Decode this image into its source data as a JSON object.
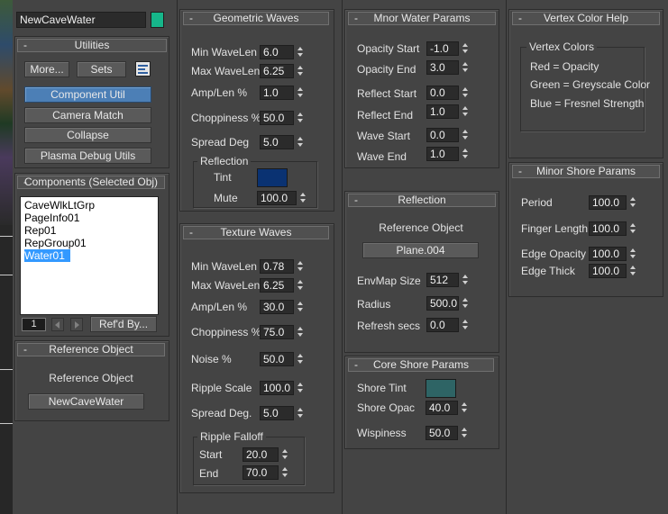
{
  "object_name": "NewCaveWater",
  "colors": {
    "object_color": "#16b68a",
    "reflection_tint": "#0a3272",
    "shore_tint": "#2e6465",
    "selected": "#3399ff",
    "active_button": "#4c7fb6"
  },
  "utilities": {
    "title": "Utilities",
    "more": "More...",
    "sets": "Sets",
    "config_icon": "configure-icon",
    "buttons": [
      "Component Util",
      "Camera Match",
      "Collapse",
      "Plasma Debug Utils"
    ]
  },
  "components": {
    "title": "Components (Selected Obj)",
    "items": [
      "CaveWlkLtGrp",
      "PageInfo01",
      "Rep01",
      "RepGroup01",
      "Water01"
    ],
    "page": "1",
    "refd_by": "Ref'd By..."
  },
  "reference_object_left": {
    "title": "Reference Object",
    "label": "Reference Object",
    "button": "NewCaveWater"
  },
  "geometric_waves": {
    "title": "Geometric Waves",
    "min_wavelen": {
      "label": "Min WaveLen",
      "value": "6.0"
    },
    "max_wavelen": {
      "label": "Max WaveLen",
      "value": "6.25"
    },
    "amp_len": {
      "label": "Amp/Len %",
      "value": "1.0"
    },
    "choppiness": {
      "label": "Choppiness %",
      "value": "50.0"
    },
    "spread": {
      "label": "Spread Deg",
      "value": "5.0"
    },
    "reflection_group": "Reflection",
    "tint_label": "Tint",
    "mute": {
      "label": "Mute",
      "value": "100.0"
    }
  },
  "texture_waves": {
    "title": "Texture Waves",
    "min_wavelen": {
      "label": "Min WaveLen",
      "value": "0.78"
    },
    "max_wavelen": {
      "label": "Max WaveLen",
      "value": "6.25"
    },
    "amp_len": {
      "label": "Amp/Len %",
      "value": "30.0"
    },
    "choppiness": {
      "label": "Choppiness %",
      "value": "75.0"
    },
    "noise": {
      "label": "Noise %",
      "value": "50.0"
    },
    "ripple_scale": {
      "label": "Ripple Scale",
      "value": "100.0"
    },
    "spread": {
      "label": "Spread Deg.",
      "value": "5.0"
    },
    "ripple_falloff_group": "Ripple Falloff",
    "start": {
      "label": "Start",
      "value": "20.0"
    },
    "end": {
      "label": "End",
      "value": "70.0"
    }
  },
  "minor_water": {
    "title": "Mnor Water Params",
    "opacity_start": {
      "label": "Opacity Start",
      "value": "-1.0"
    },
    "opacity_end": {
      "label": "Opacity End",
      "value": "3.0"
    },
    "reflect_start": {
      "label": "Reflect Start",
      "value": "0.0"
    },
    "reflect_end": {
      "label": "Reflect End",
      "value": "1.0"
    },
    "wave_start": {
      "label": "Wave Start",
      "value": "0.0"
    },
    "wave_end": {
      "label": "Wave End",
      "value": "1.0"
    }
  },
  "reflection": {
    "title": "Reflection",
    "ref_label": "Reference Object",
    "ref_button": "Plane.004",
    "envmap": {
      "label": "EnvMap Size",
      "value": "512"
    },
    "radius": {
      "label": "Radius",
      "value": "500.0"
    },
    "refresh": {
      "label": "Refresh secs",
      "value": "0.0"
    }
  },
  "core_shore": {
    "title": "Core Shore Params",
    "tint_label": "Shore Tint",
    "opac": {
      "label": "Shore Opac",
      "value": "40.0"
    },
    "wispiness": {
      "label": "Wispiness",
      "value": "50.0"
    }
  },
  "vertex_help": {
    "title": "Vertex Color Help",
    "group": "Vertex Colors",
    "lines": [
      "Red = Opacity",
      "Green = Greyscale Color",
      "Blue = Fresnel Strength"
    ]
  },
  "minor_shore": {
    "title": "Minor Shore Params",
    "period": {
      "label": "Period",
      "value": "100.0"
    },
    "finger": {
      "label": "Finger Length",
      "value": "100.0"
    },
    "edge_opacity": {
      "label": "Edge Opacity",
      "value": "100.0"
    },
    "edge_thick": {
      "label": "Edge Thick",
      "value": "100.0"
    }
  },
  "minus_symbol": "-"
}
